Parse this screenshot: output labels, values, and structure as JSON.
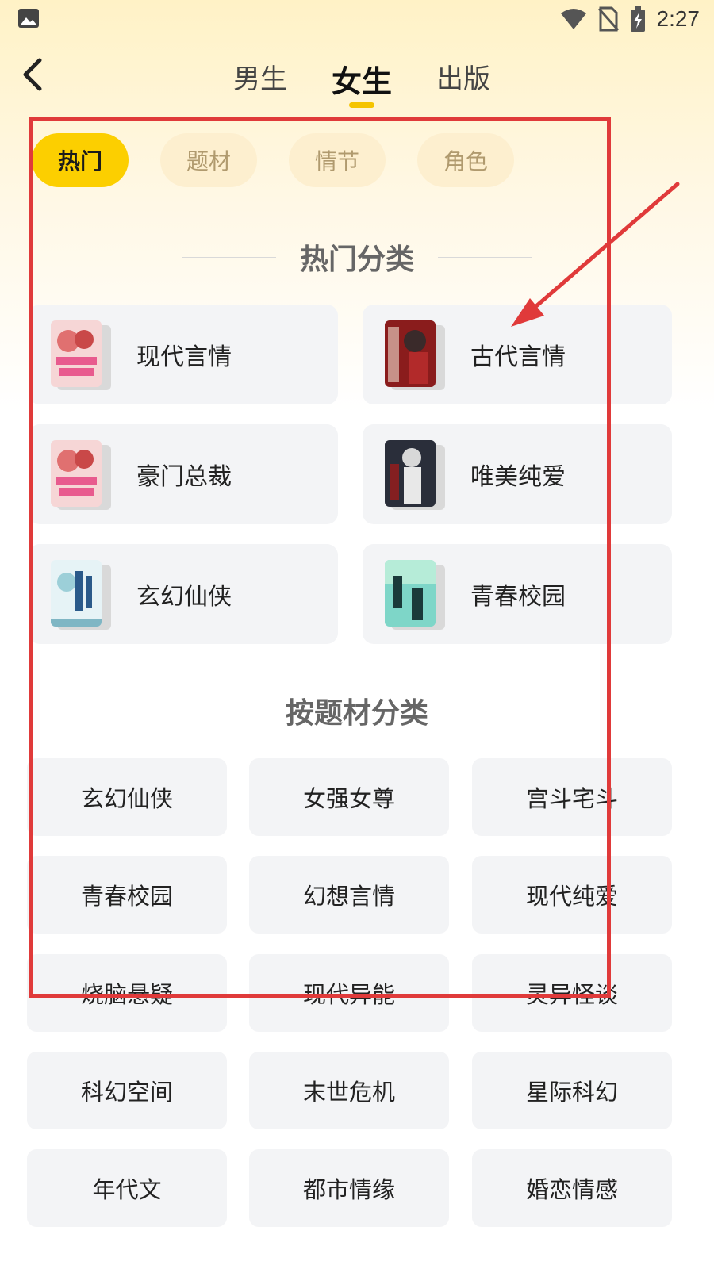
{
  "status_bar": {
    "time": "2:27",
    "icons": [
      "image-icon",
      "wifi-icon",
      "no-sim-icon",
      "battery-charging-icon"
    ]
  },
  "nav": {
    "back_icon": "chevron-left-icon",
    "tabs": [
      {
        "label": "男生",
        "active": false
      },
      {
        "label": "女生",
        "active": true
      },
      {
        "label": "出版",
        "active": false
      }
    ]
  },
  "filter_chips": [
    {
      "label": "热门",
      "active": true
    },
    {
      "label": "题材",
      "active": false
    },
    {
      "label": "情节",
      "active": false
    },
    {
      "label": "角色",
      "active": false
    }
  ],
  "hot_section": {
    "title": "热门分类",
    "items": [
      {
        "label": "现代言情"
      },
      {
        "label": "古代言情"
      },
      {
        "label": "豪门总裁"
      },
      {
        "label": "唯美纯爱"
      },
      {
        "label": "玄幻仙侠"
      },
      {
        "label": "青春校园"
      }
    ]
  },
  "genre_section": {
    "title": "按题材分类",
    "items": [
      "玄幻仙侠",
      "女强女尊",
      "宫斗宅斗",
      "青春校园",
      "幻想言情",
      "现代纯爱",
      "烧脑悬疑",
      "现代异能",
      "灵异怪谈",
      "科幻空间",
      "末世危机",
      "星际科幻",
      "年代文",
      "都市情缘",
      "婚恋情感"
    ]
  },
  "colors": {
    "accent": "#fccf00",
    "annotation": "#e03a3a",
    "card_bg": "#f3f4f6"
  }
}
